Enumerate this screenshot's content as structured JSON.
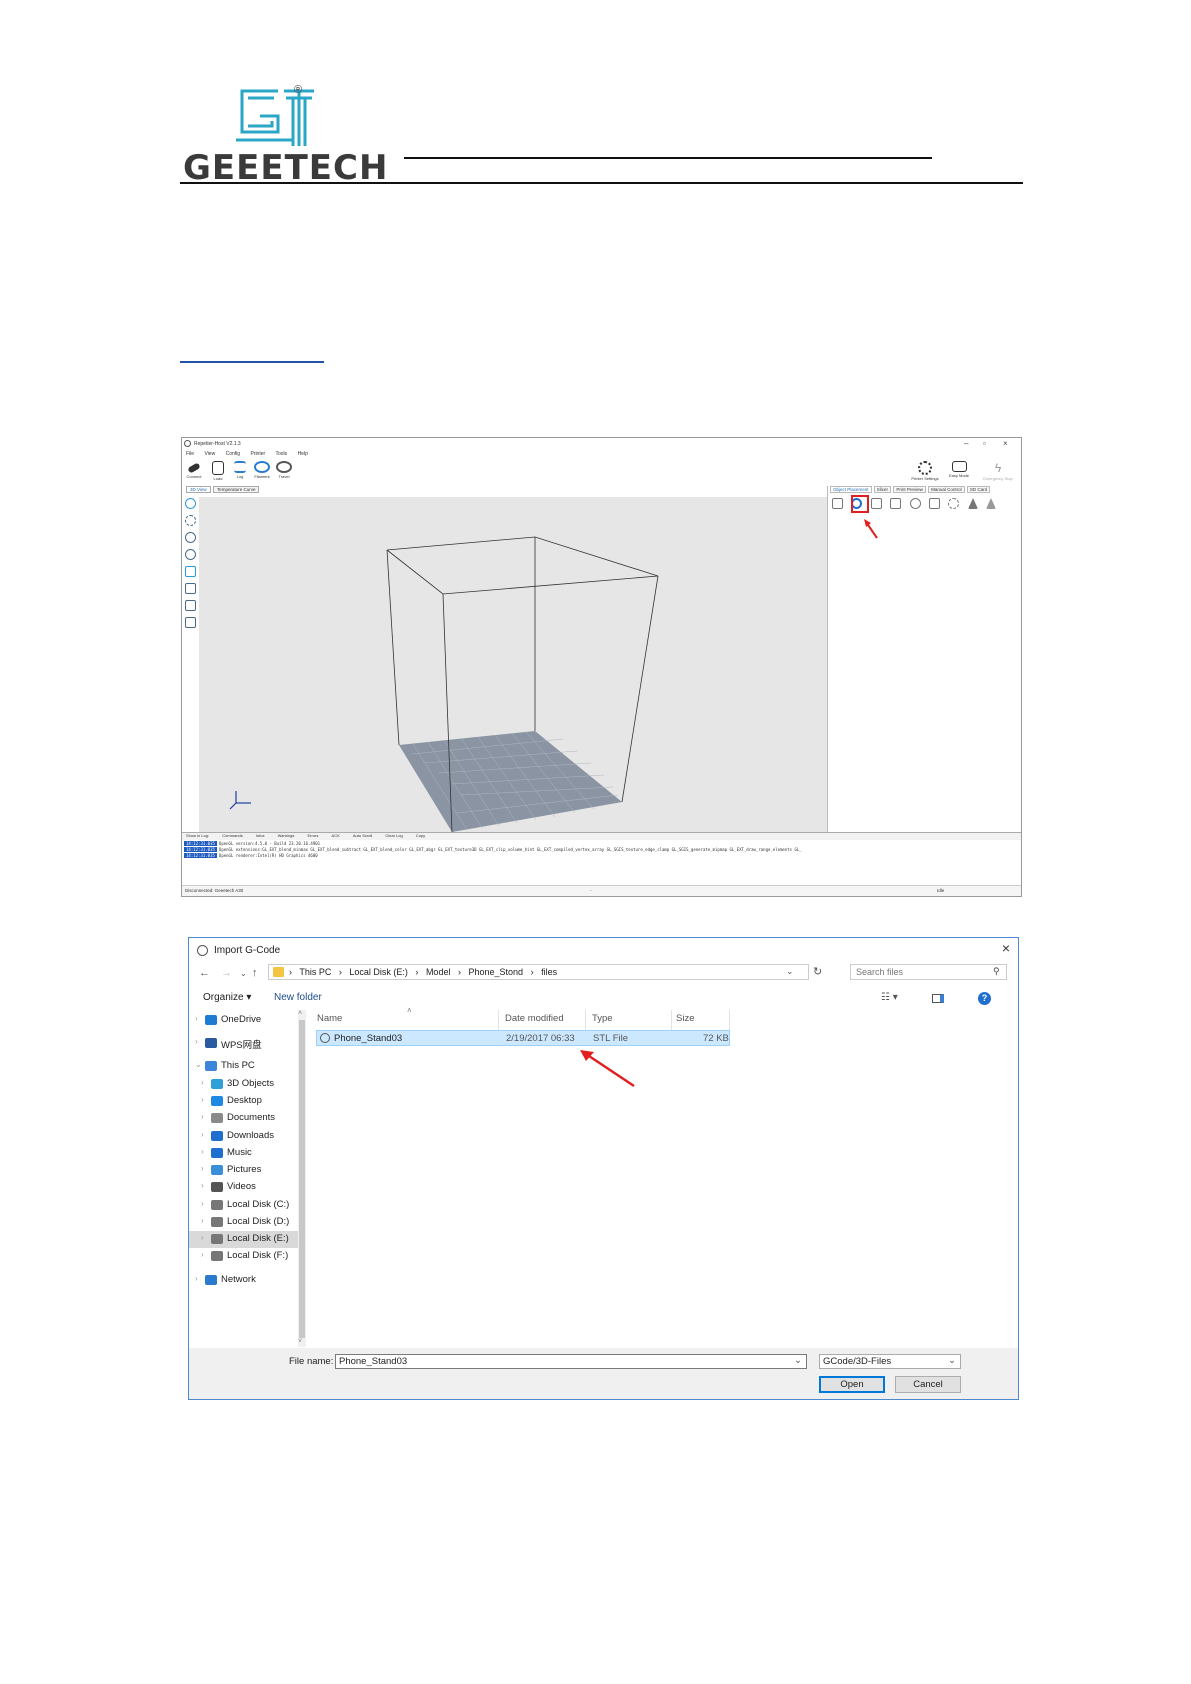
{
  "header": {
    "logo_text": "GEEETECH",
    "registered_mark": "®"
  },
  "repetier": {
    "window_title": "Repetier-Host V2.1.3",
    "menu": [
      "File",
      "View",
      "Config",
      "Printer",
      "Tools",
      "Help"
    ],
    "toolbar_left": [
      "Connect",
      "Load",
      "Log",
      "Filament",
      "Travel"
    ],
    "toolbar_right": [
      "Printer Settings",
      "Easy Mode",
      "Emergency Stop"
    ],
    "view_tabs": [
      "3D View",
      "Temperature Curve"
    ],
    "panel_tabs": [
      "Object Placement",
      "Slicer",
      "Print Preview",
      "Manual Control",
      "SD Card"
    ],
    "log_toolbar": [
      "Show in Log:",
      "Commands",
      "Infos",
      "Warnings",
      "Errors",
      "ACK",
      "Auto Scroll",
      "Clear Log",
      "Copy"
    ],
    "log_lines": [
      {
        "time": "14:12:31.035",
        "text": "OpenGL version:4.5.0 - Build 23.20.16.4901"
      },
      {
        "time": "14:12:31.035",
        "text": "OpenGL extensions:GL_EXT_blend_minmax GL_EXT_blend_subtract GL_EXT_blend_color GL_EXT_abgr GL_EXT_texture3D GL_EXT_clip_volume_hint GL_EXT_compiled_vertex_array GL_SGIS_texture_edge_clamp GL_SGIS_generate_mipmap GL_EXT_draw_range_elements GL_"
      },
      {
        "time": "14:12:31.035",
        "text": "OpenGL renderer:Intel(R) HD Graphics 4600"
      }
    ],
    "status_left": "Disconnected: Geeetech A30",
    "status_mid": "-",
    "status_right": "Idle"
  },
  "dialog": {
    "title": "Import G-Code",
    "breadcrumb": [
      "This PC",
      "Local Disk (E:)",
      "Model",
      "Phone_Stond",
      "files"
    ],
    "search_placeholder": "Search files",
    "organize": "Organize ▾",
    "new_folder": "New folder",
    "nav_items": [
      {
        "label": "OneDrive",
        "icon": "cloud-icon",
        "color": "#1e7bd4"
      },
      {
        "label": "WPS网盘",
        "icon": "cloud-outline-icon",
        "color": "#2a5aa0"
      },
      {
        "label": "This PC",
        "icon": "computer-icon",
        "color": "#3b86d8"
      },
      {
        "label": "3D Objects",
        "icon": "cube-icon",
        "color": "#2fa0d8"
      },
      {
        "label": "Desktop",
        "icon": "desktop-icon",
        "color": "#1e88e5"
      },
      {
        "label": "Documents",
        "icon": "document-icon",
        "color": "#8a8a8a"
      },
      {
        "label": "Downloads",
        "icon": "download-icon",
        "color": "#1e6fd0"
      },
      {
        "label": "Music",
        "icon": "music-icon",
        "color": "#1e6fd0"
      },
      {
        "label": "Pictures",
        "icon": "picture-icon",
        "color": "#3a8fd8"
      },
      {
        "label": "Videos",
        "icon": "video-icon",
        "color": "#555555"
      },
      {
        "label": "Local Disk (C:)",
        "icon": "windows-disk-icon",
        "color": "#777777"
      },
      {
        "label": "Local Disk (D:)",
        "icon": "disk-icon",
        "color": "#777777"
      },
      {
        "label": "Local Disk (E:)",
        "icon": "disk-icon",
        "color": "#777777"
      },
      {
        "label": "Local Disk (F:)",
        "icon": "disk-icon",
        "color": "#777777"
      },
      {
        "label": "Network",
        "icon": "network-icon",
        "color": "#2a7ad0"
      }
    ],
    "columns": {
      "name": "Name",
      "date": "Date modified",
      "type": "Type",
      "size": "Size"
    },
    "file": {
      "name": "Phone_Stand03",
      "date": "2/19/2017 06:33",
      "type": "STL File",
      "size": "72 KB"
    },
    "file_name_label": "File name:",
    "file_name_value": "Phone_Stand03",
    "file_type_value": "GCode/3D-Files",
    "open_label": "Open",
    "cancel_label": "Cancel"
  }
}
